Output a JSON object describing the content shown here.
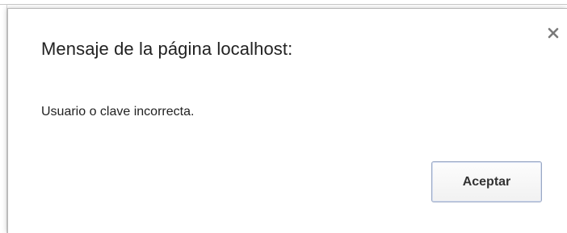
{
  "dialog": {
    "title": "Mensaje de la página localhost:",
    "message": "Usuario o clave incorrecta.",
    "close_icon": "close-icon",
    "accept_label": "Aceptar"
  },
  "colors": {
    "text": "#222222",
    "button_border": "#9aa8c4",
    "close_icon": "#7a7a7a"
  }
}
